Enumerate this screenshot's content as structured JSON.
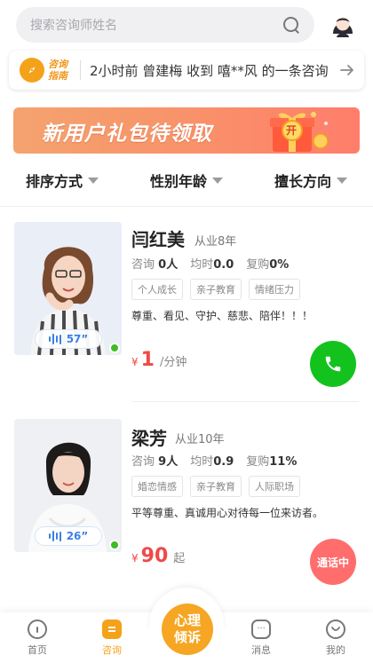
{
  "search": {
    "placeholder": "搜索咨询师姓名"
  },
  "notice": {
    "logo_text": "咨询指南",
    "message": "2小时前 曾建梅 收到 嘻**风 的一条咨询"
  },
  "banner": {
    "text": "新用户礼包待领取",
    "gift_label": "开"
  },
  "filters": [
    {
      "label": "排序方式"
    },
    {
      "label": "性别年龄"
    },
    {
      "label": "擅长方向"
    }
  ],
  "counselors": [
    {
      "name": "闫红美",
      "years": "从业8年",
      "consult_label": "咨询",
      "consult_value": "0人",
      "rating_label": "均时",
      "rating_value": "0.0",
      "repeat_label": "复购",
      "repeat_value": "0%",
      "tags": [
        "个人成长",
        "亲子教育",
        "情绪压力"
      ],
      "description": "尊重、看见、守护、慈悲、陪伴！！！",
      "voice_duration": "57”",
      "price_currency": "¥",
      "price_value": "1",
      "price_unit": "/分钟",
      "status": "online"
    },
    {
      "name": "梁芳",
      "years": "从业10年",
      "consult_label": "咨询",
      "consult_value": "9人",
      "rating_label": "均时",
      "rating_value": "0.9",
      "repeat_label": "复购",
      "repeat_value": "11%",
      "tags": [
        "婚恋情感",
        "亲子教育",
        "人际职场"
      ],
      "description": "平等尊重、真诚用心对待每一位来访者。",
      "voice_duration": "26”",
      "price_currency": "¥",
      "price_value": "90",
      "price_unit": "起",
      "action_label": "通话中",
      "status": "online"
    }
  ],
  "bottom_nav": {
    "home": "首页",
    "consult": "咨询",
    "center_line1": "心理",
    "center_line2": "倾诉",
    "messages": "消息",
    "mine": "我的"
  },
  "colors": {
    "accent": "#f3a21a",
    "call_green": "#14c21e",
    "busy_red": "#ff6d6d",
    "price_red": "#f14848",
    "online_green": "#3dbd26"
  }
}
